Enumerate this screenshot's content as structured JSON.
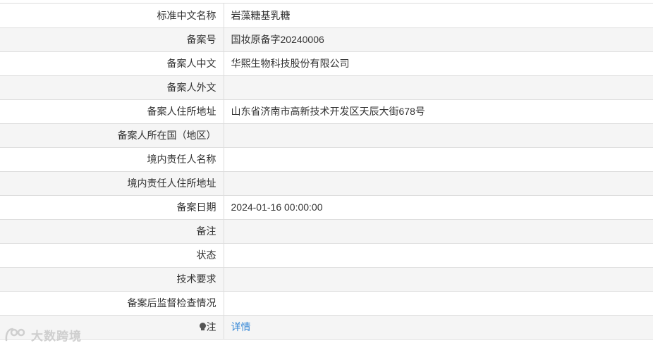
{
  "rows": [
    {
      "label": "标准中文名称",
      "value": "岩藻糖基乳糖"
    },
    {
      "label": "备案号",
      "value": "国妆原备字20240006"
    },
    {
      "label": "备案人中文",
      "value": "华熙生物科技股份有限公司"
    },
    {
      "label": "备案人外文",
      "value": ""
    },
    {
      "label": "备案人住所地址",
      "value": "山东省济南市高新技术开发区天辰大街678号"
    },
    {
      "label": "备案人所在国（地区）",
      "value": ""
    },
    {
      "label": "境内责任人名称",
      "value": ""
    },
    {
      "label": "境内责任人住所地址",
      "value": ""
    },
    {
      "label": "备案日期",
      "value": "2024-01-16 00:00:00"
    },
    {
      "label": "备注",
      "value": ""
    },
    {
      "label": "状态",
      "value": ""
    },
    {
      "label": "技术要求",
      "value": ""
    },
    {
      "label": "备案后监督检查情况",
      "value": ""
    }
  ],
  "note_row": {
    "icon": "lightbulb-icon",
    "label": "注",
    "link_text": "详情"
  },
  "watermark": {
    "text": "大数跨境"
  },
  "colors": {
    "link": "#3a8ad8",
    "stripe": "#f5f5f5",
    "border": "#dddddd"
  }
}
